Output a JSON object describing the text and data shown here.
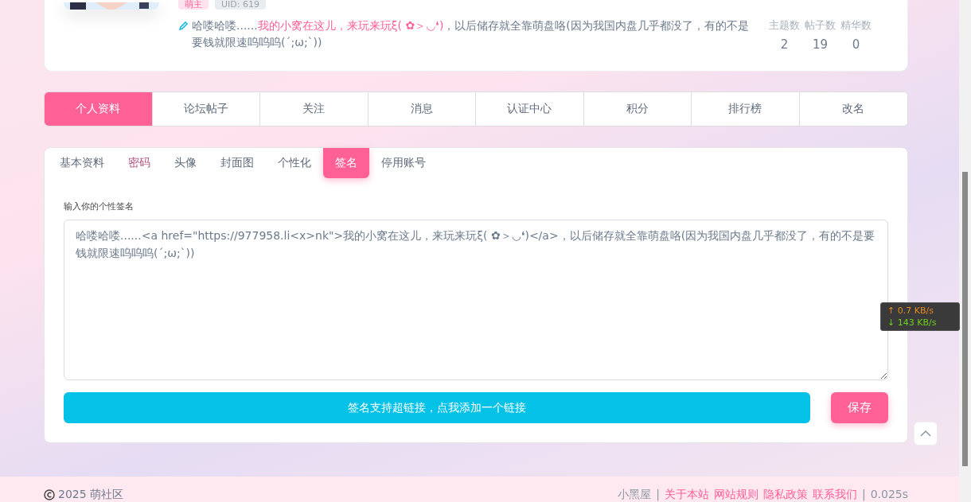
{
  "profile": {
    "badges": [
      {
        "label": "萌主",
        "kind": "role"
      },
      {
        "label": "UID: 619",
        "kind": "uid"
      }
    ],
    "signature": [
      {
        "text": "哈喽哈喽......",
        "link": false
      },
      {
        "text": "我的小窝在这儿，来玩来玩ξ( ✿＞◡❛)",
        "link": true
      },
      {
        "text": "，以后储存就全靠萌盘咯(因为我国内盘几乎都没了，有的不是要钱就限速呜呜呜(´;ω;`))",
        "link": false
      }
    ],
    "stats": [
      {
        "label": "主题数",
        "value": "2"
      },
      {
        "label": "帖子数",
        "value": "19"
      },
      {
        "label": "精华数",
        "value": "0"
      }
    ]
  },
  "nav": [
    {
      "label": "个人资料",
      "selected": true
    },
    {
      "label": "论坛帖子",
      "selected": false
    },
    {
      "label": "关注",
      "selected": false
    },
    {
      "label": "消息",
      "selected": false
    },
    {
      "label": "认证中心",
      "selected": false
    },
    {
      "label": "积分",
      "selected": false
    },
    {
      "label": "排行榜",
      "selected": false
    },
    {
      "label": "改名",
      "selected": false
    }
  ],
  "subtabs": [
    {
      "label": "基本资料",
      "selected": false,
      "visited": false
    },
    {
      "label": "密码",
      "selected": false,
      "visited": true
    },
    {
      "label": "头像",
      "selected": false,
      "visited": false
    },
    {
      "label": "封面图",
      "selected": false,
      "visited": false
    },
    {
      "label": "个性化",
      "selected": false,
      "visited": false
    },
    {
      "label": "签名",
      "selected": true,
      "visited": false
    },
    {
      "label": "停用账号",
      "selected": false,
      "visited": false
    }
  ],
  "form": {
    "label": "输入你的个性签名",
    "value": "哈喽哈喽......<a href=\"https://977958.li<x>nk\">我的小窝在这儿，来玩来玩ξ( ✿＞◡❛)</a>，以后储存就全靠萌盘咯(因为我国内盘几乎都没了，有的不是要钱就限速呜呜呜(´;ω;`))",
    "link_button": "签名支持超链接，点我添加一个链接",
    "save_button": "保存"
  },
  "net_speed": {
    "up": "↑ 0.7 KB/s",
    "down": "↓ 143 KB/s"
  },
  "footer": {
    "copyright": "2025 萌社区",
    "links": [
      {
        "label": "小黑屋",
        "kind": "plain"
      },
      {
        "label": "|",
        "kind": "sep"
      },
      {
        "label": "关于本站",
        "kind": "link"
      },
      {
        "label": "网站规则",
        "kind": "link"
      },
      {
        "label": "隐私政策",
        "kind": "link"
      },
      {
        "label": "联系我们",
        "kind": "link"
      },
      {
        "label": "|",
        "kind": "sep"
      },
      {
        "label": "0.025s",
        "kind": "plain"
      }
    ]
  }
}
